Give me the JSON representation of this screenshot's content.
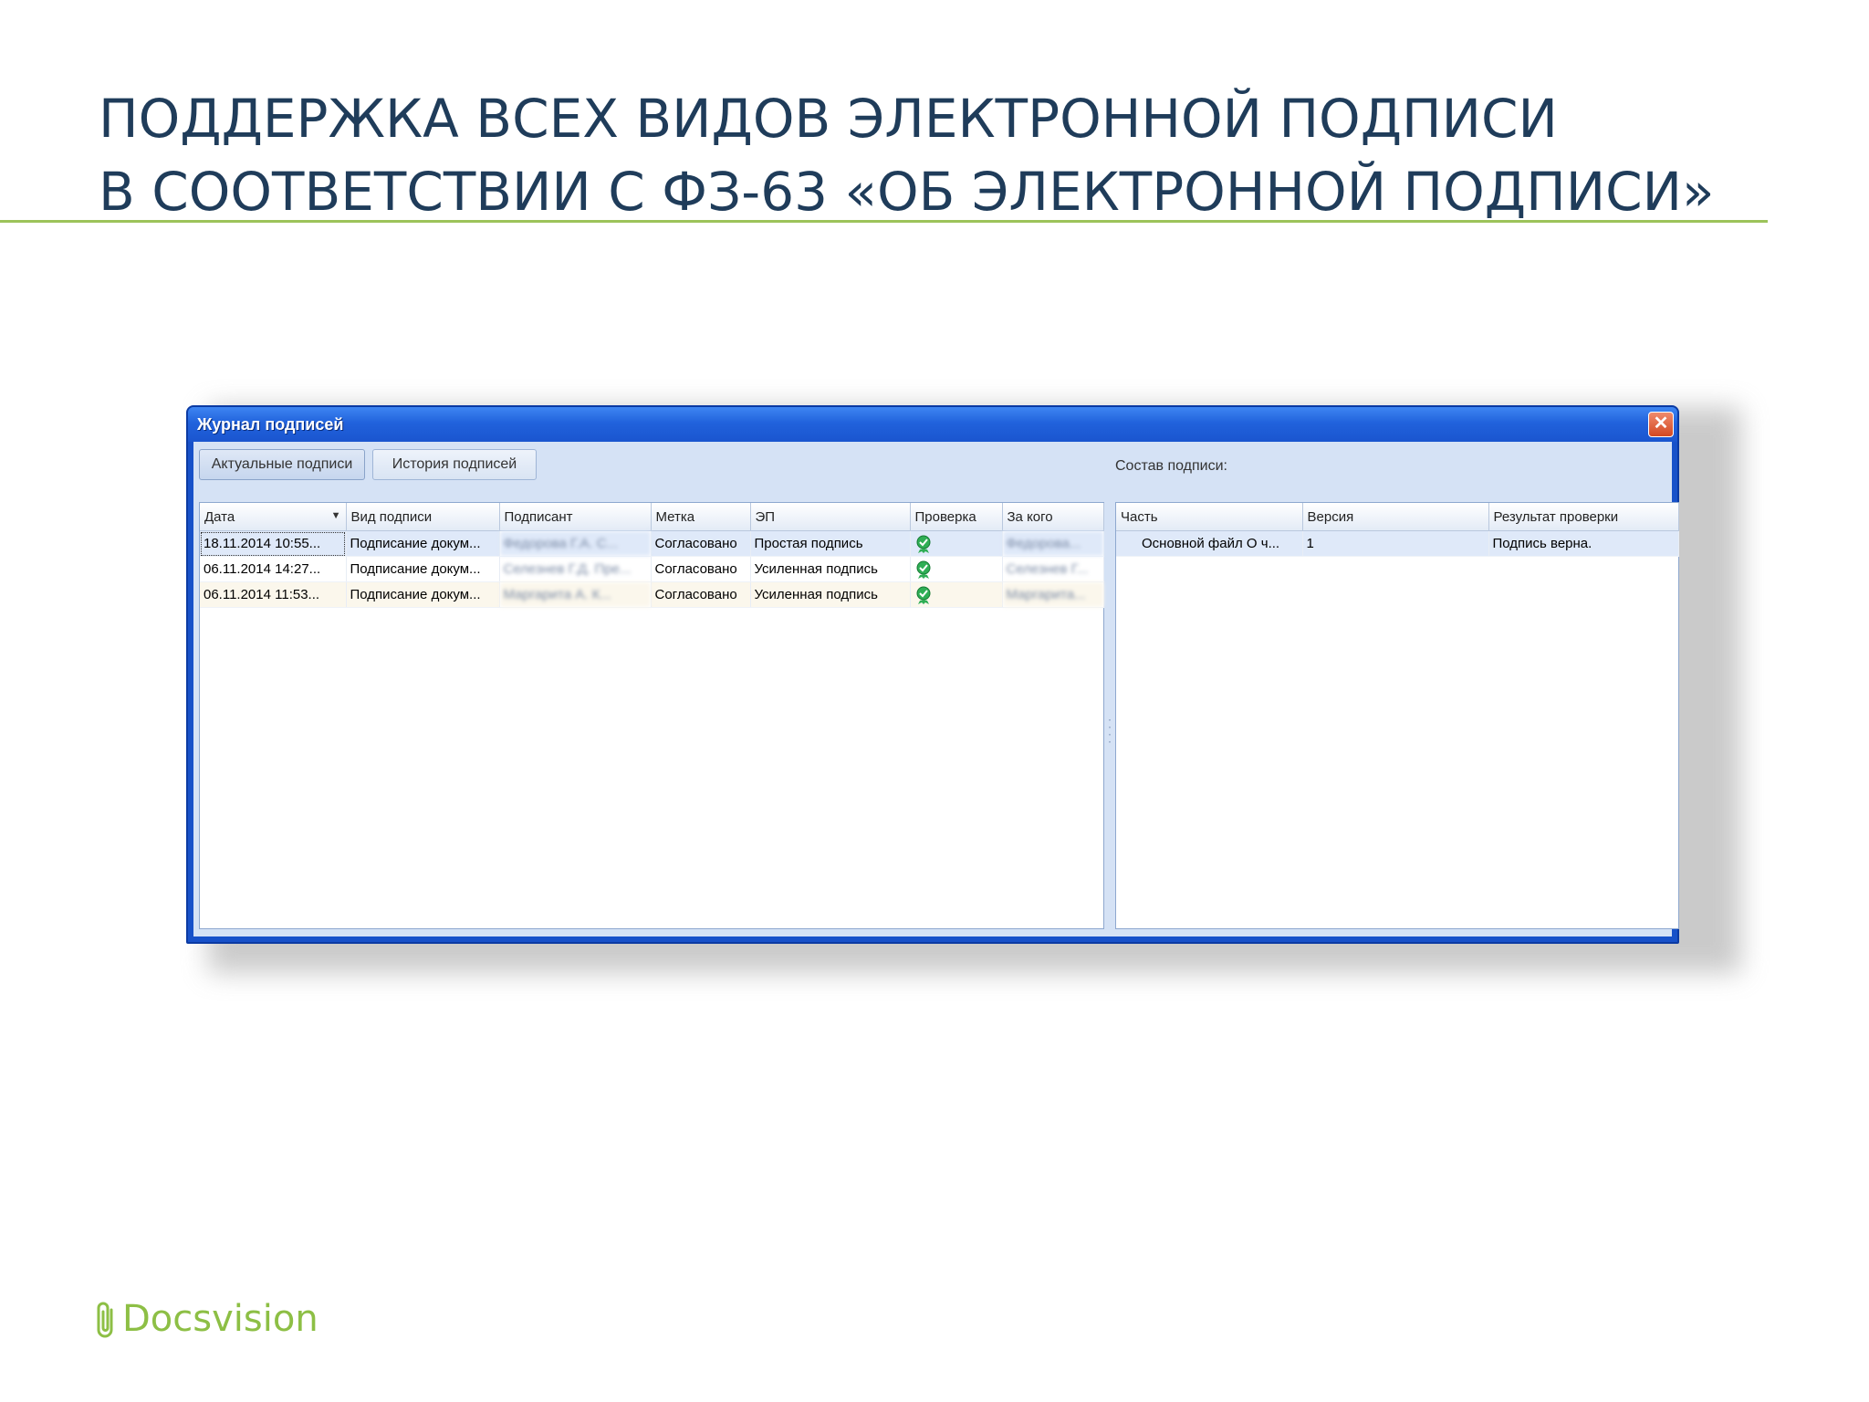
{
  "slide": {
    "title_line1": "ПОДДЕРЖКА ВСЕХ ВИДОВ ЭЛЕКТРОННОЙ ПОДПИСИ",
    "title_line2": "В СООТВЕТСТВИИ С ФЗ-63 «ОБ ЭЛЕКТРОННОЙ ПОДПИСИ»",
    "accent_color": "#9cc35a",
    "logo_text": "Docsvision"
  },
  "window": {
    "title": "Журнал подписей",
    "close_label": "✕",
    "tabs": [
      {
        "label": "Актуальные подписи",
        "active": true
      },
      {
        "label": "История подписей",
        "active": false
      }
    ],
    "signatures": {
      "columns": [
        "Дата",
        "Вид подписи",
        "Подписант",
        "Метка",
        "ЭП",
        "Проверка",
        "За кого"
      ],
      "rows": [
        {
          "date": "18.11.2014 10:55...",
          "kind": "Подписание докум...",
          "signer": "Федорова Г.А. С...",
          "mark": "Согласовано",
          "ep": "Простая подпись",
          "check": "check-ok-icon",
          "on_behalf": "Федорова..."
        },
        {
          "date": "06.11.2014 14:27...",
          "kind": "Подписание докум...",
          "signer": "Селезнев Г.Д. Пре...",
          "mark": "Согласовано",
          "ep": "Усиленная подпись",
          "check": "check-ok-icon",
          "on_behalf": "Селезнев Г..."
        },
        {
          "date": "06.11.2014 11:53...",
          "kind": "Подписание докум...",
          "signer": "Маргарита А. К...",
          "mark": "Согласовано",
          "ep": "Усиленная подпись",
          "check": "check-ok-icon",
          "on_behalf": "Маргарита..."
        }
      ]
    },
    "composition": {
      "caption": "Состав подписи:",
      "columns": [
        "Часть",
        "Версия",
        "Результат проверки"
      ],
      "rows": [
        {
          "part": "Основной файл О ч...",
          "version": "1",
          "result": "Подпись верна."
        }
      ]
    }
  }
}
